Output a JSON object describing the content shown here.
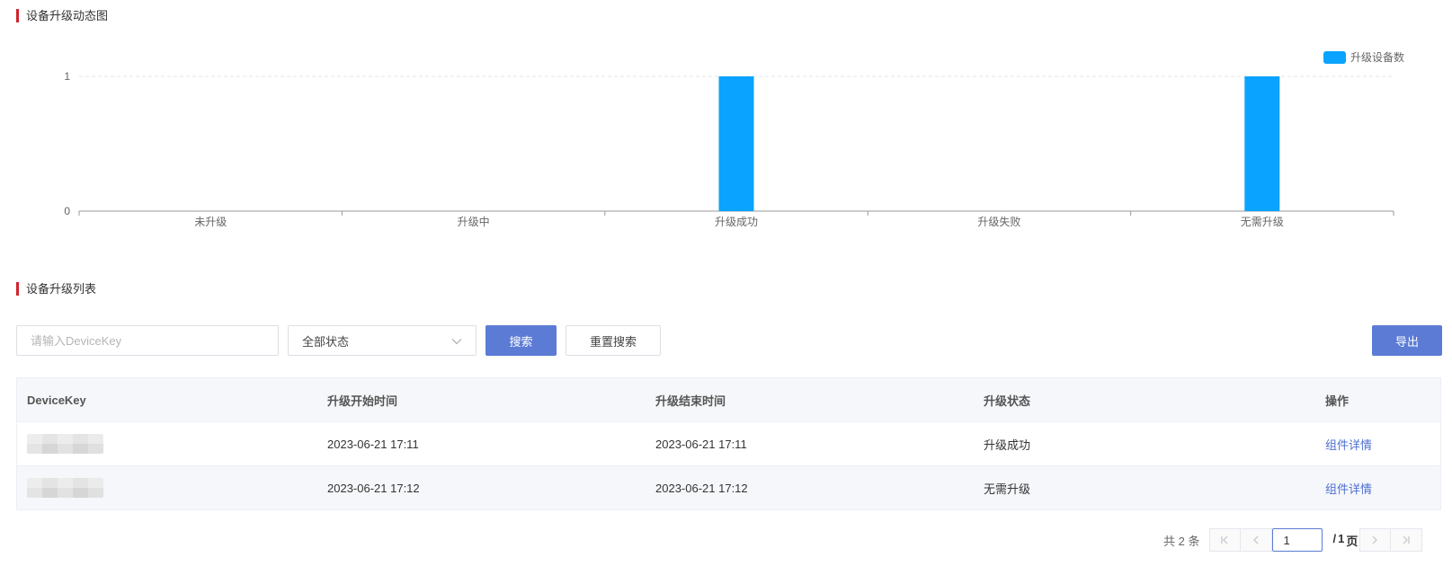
{
  "chart_section": {
    "title": "设备升级动态图"
  },
  "list_section": {
    "title": "设备升级列表"
  },
  "chart_data": {
    "type": "bar",
    "categories": [
      "未升级",
      "升级中",
      "升级成功",
      "升级失败",
      "无需升级"
    ],
    "series": [
      {
        "name": "升级设备数",
        "values": [
          0,
          0,
          1,
          0,
          1
        ],
        "color": "#0aa3ff"
      }
    ],
    "ylim": [
      0,
      1
    ],
    "yticks": [
      "0",
      "1"
    ],
    "grid": true,
    "legend": "top-right"
  },
  "search": {
    "placeholder": "请输入DeviceKey",
    "value": ""
  },
  "status_select": {
    "value": "全部状态",
    "icon": "chevron-down-icon"
  },
  "buttons": {
    "search": "搜索",
    "reset": "重置搜索",
    "export": "导出"
  },
  "table": {
    "headers": [
      "DeviceKey",
      "升级开始时间",
      "升级结束时间",
      "升级状态",
      "操作"
    ],
    "rows": [
      {
        "device_key": "",
        "start": "2023-06-21 17:11",
        "end": "2023-06-21 17:11",
        "status": "升级成功",
        "action": "组件详情"
      },
      {
        "device_key": "",
        "start": "2023-06-21 17:12",
        "end": "2023-06-21 17:12",
        "status": "无需升级",
        "action": "组件详情"
      }
    ]
  },
  "pagination": {
    "total_prefix": "共",
    "total": "2",
    "total_suffix": "条",
    "current_page": "1",
    "of_prefix": "/",
    "total_pages": "1",
    "page_suffix": "页",
    "icons": [
      "first-page-icon",
      "prev-page-icon",
      "next-page-icon",
      "last-page-icon"
    ]
  },
  "colors": {
    "accent": "#d0232e",
    "primary": "#5b7bd5",
    "bar": "#0aa3ff",
    "link": "#4d6fd1"
  }
}
